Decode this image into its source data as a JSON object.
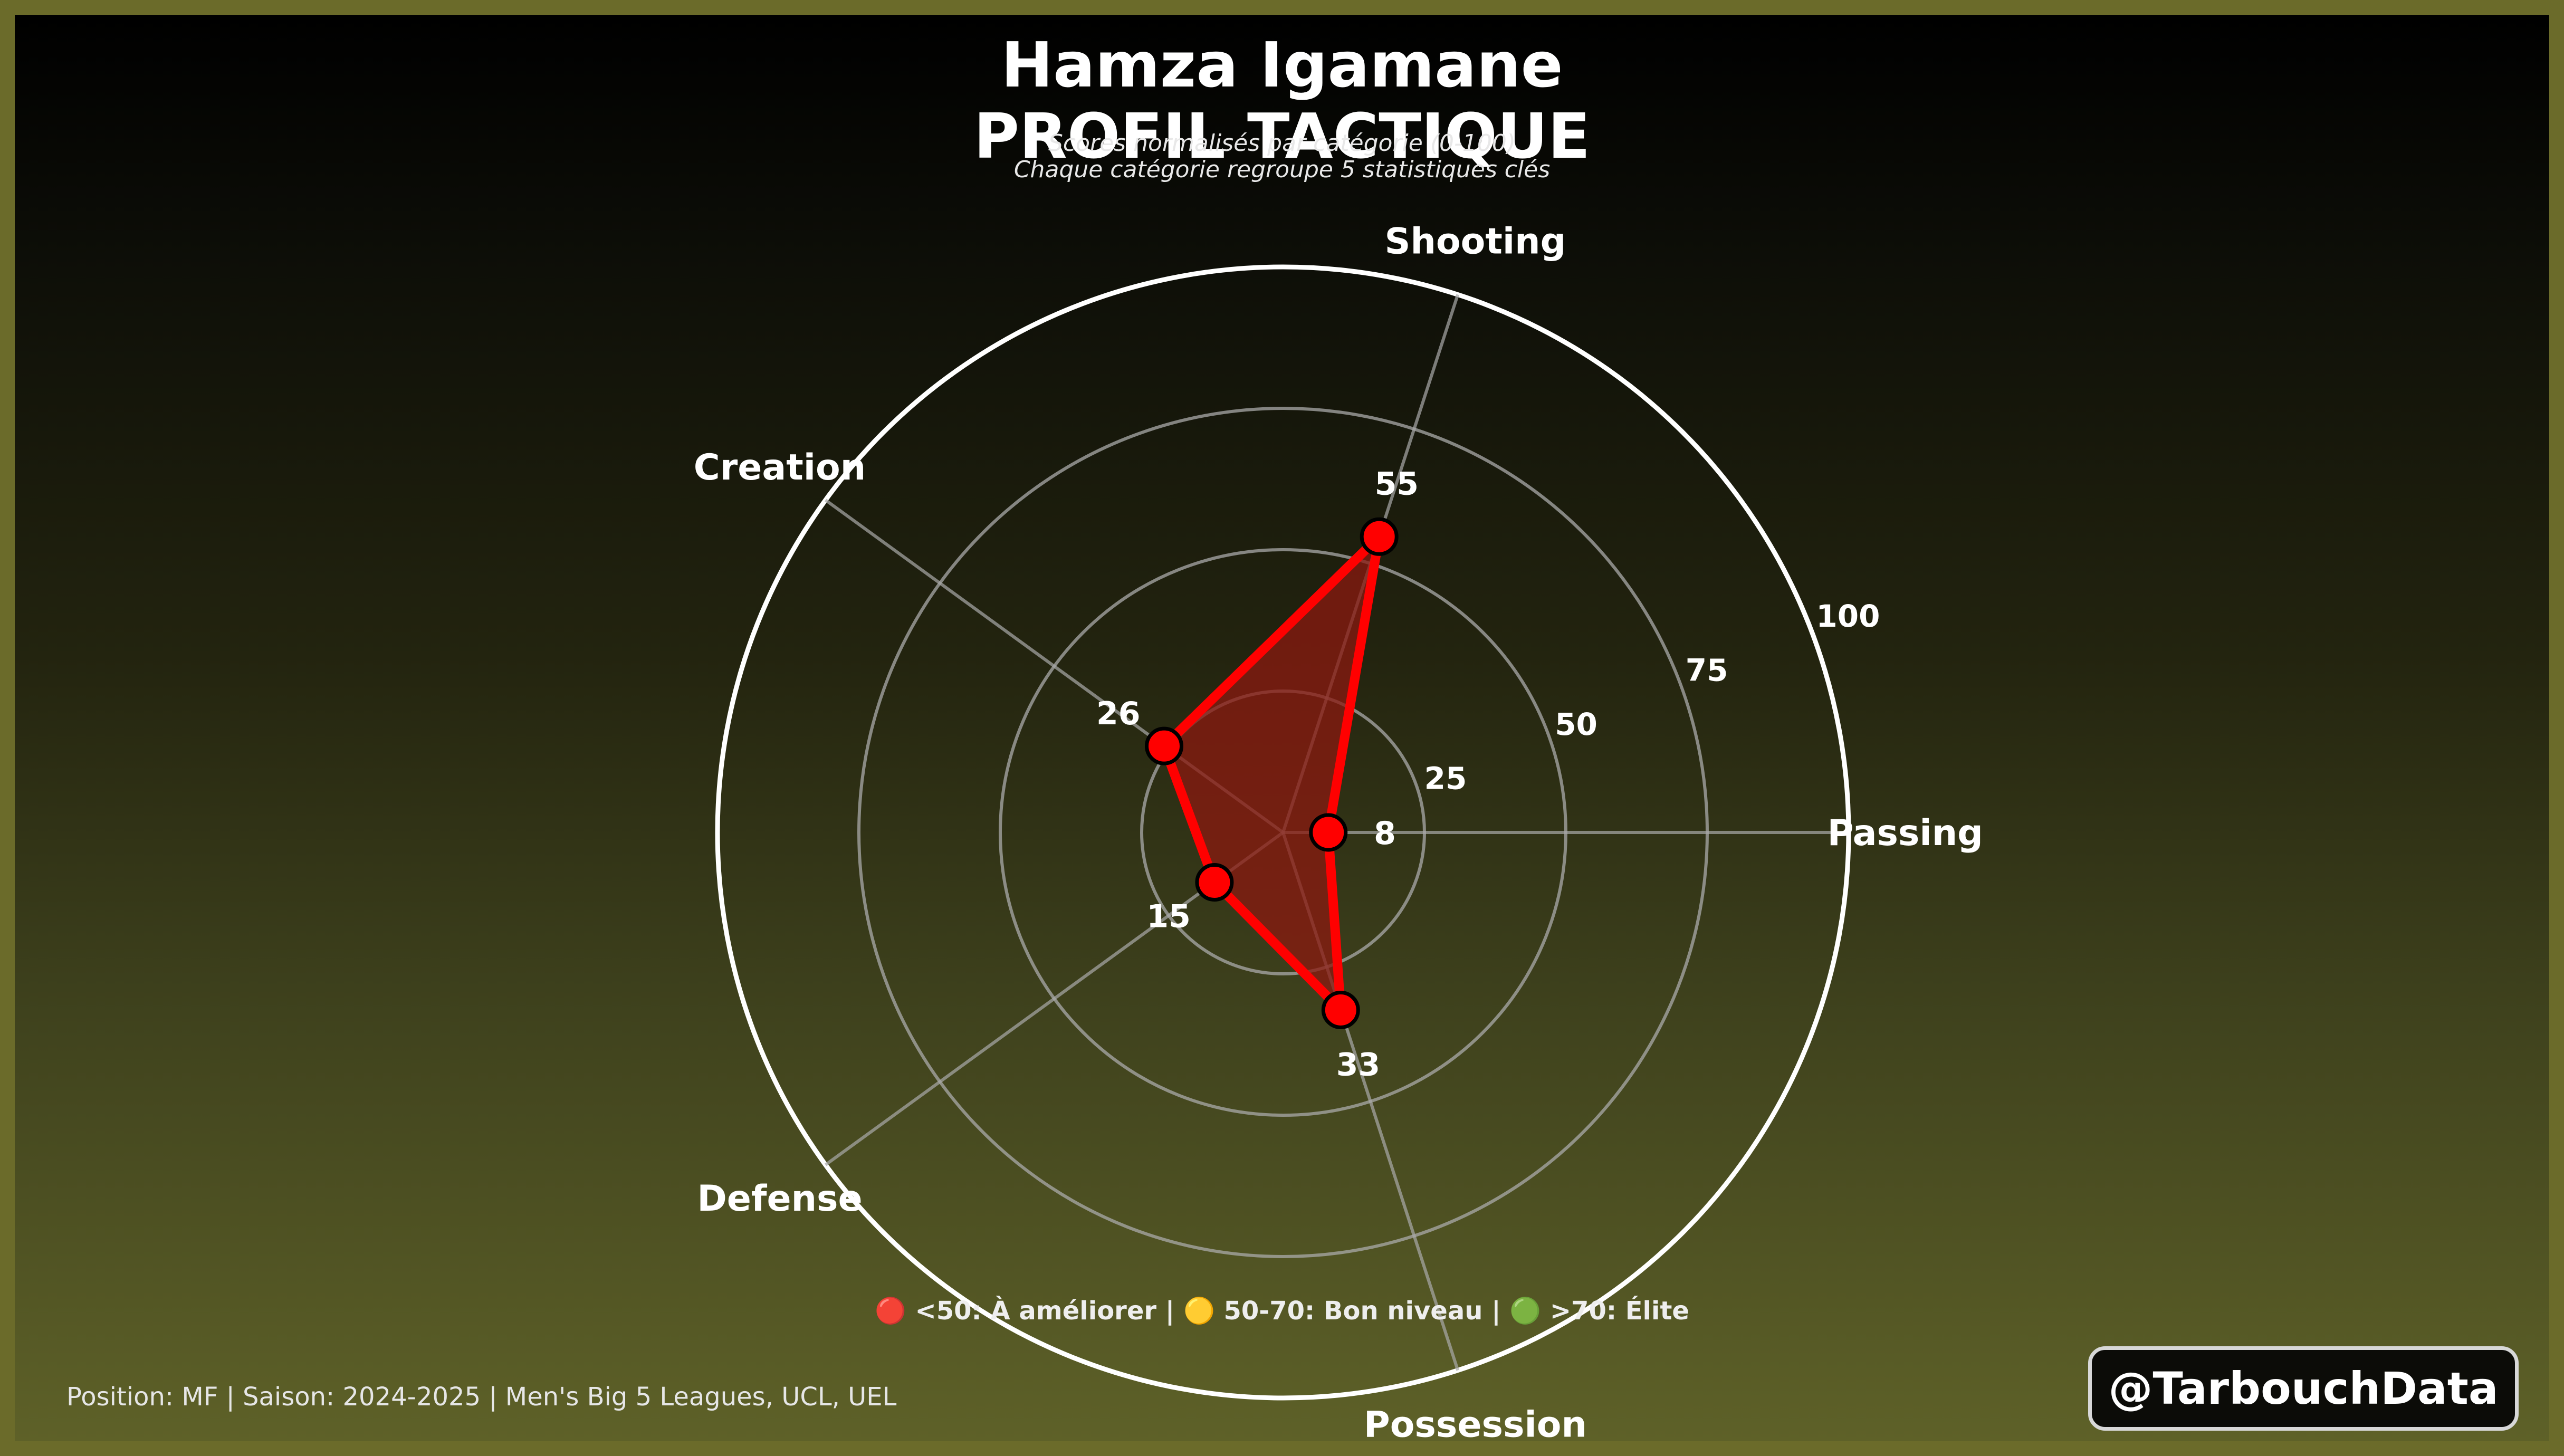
{
  "header": {
    "player": "Hamza Igamane",
    "title": "PROFIL TACTIQUE",
    "note_line1": "Scores normalisés par catégorie (0-100)",
    "note_line2": "Chaque catégorie regroupe 5 statistiques clés"
  },
  "legend_text": "🔴 <50: À améliorer  |  🟡 50-70: Bon niveau  |  🟢 >70: Élite",
  "footer_text": "Position: MF | Saison: 2024-2025 | Men's Big 5 Leagues, UCL, UEL",
  "handle": "@TarbouchData",
  "colors": {
    "series": "#ff0000",
    "fill": "#8b1a10",
    "grid": "#aaaaaa",
    "outer": "#ffffff"
  },
  "chart_data": {
    "type": "radar",
    "categories": [
      "Passing",
      "Shooting",
      "Creation",
      "Defense",
      "Possession"
    ],
    "values": [
      8,
      55,
      26,
      15,
      33
    ],
    "rlim": [
      0,
      100
    ],
    "ticks": [
      25,
      50,
      75,
      100
    ],
    "tick_labels": [
      "25",
      "50",
      "75",
      "100"
    ],
    "value_labels": [
      "8",
      "55",
      "26",
      "15",
      "33"
    ],
    "grid": true
  }
}
